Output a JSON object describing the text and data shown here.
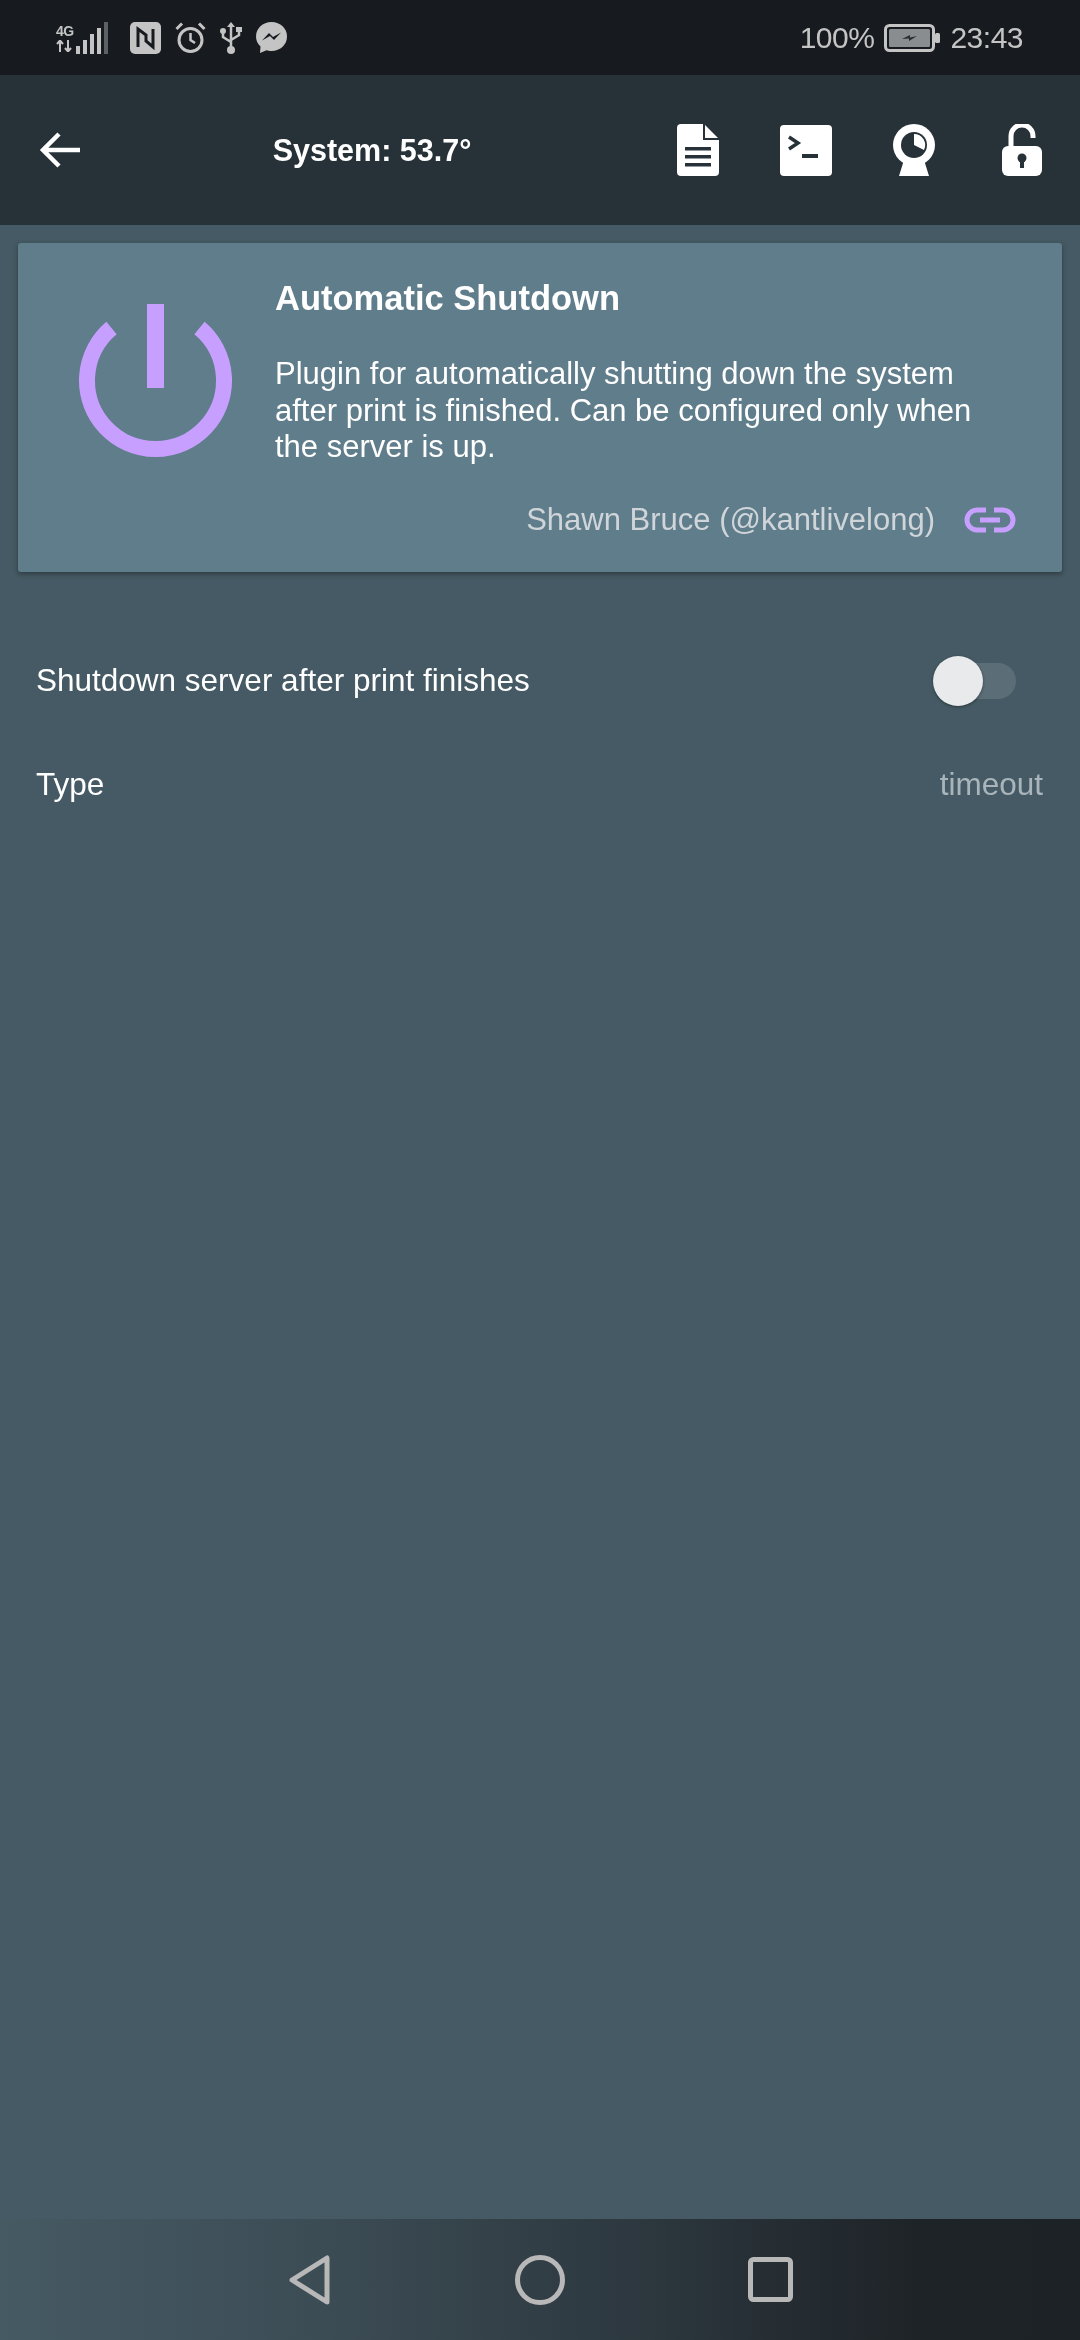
{
  "status_bar": {
    "network_type": "4G",
    "battery": "100%",
    "time": "23:43"
  },
  "app_bar": {
    "title": "System: 53.7°"
  },
  "plugin_card": {
    "title": "Automatic Shutdown",
    "description": "Plugin for automatically shutting down the system after print is finished. Can be configured only when the server is up.",
    "author": "Shawn Bruce (@kantlivelong)"
  },
  "settings": [
    {
      "kind": "switch",
      "label": "Shutdown server after print finishes",
      "on": false
    },
    {
      "kind": "value",
      "label": "Type",
      "value": "timeout"
    }
  ]
}
